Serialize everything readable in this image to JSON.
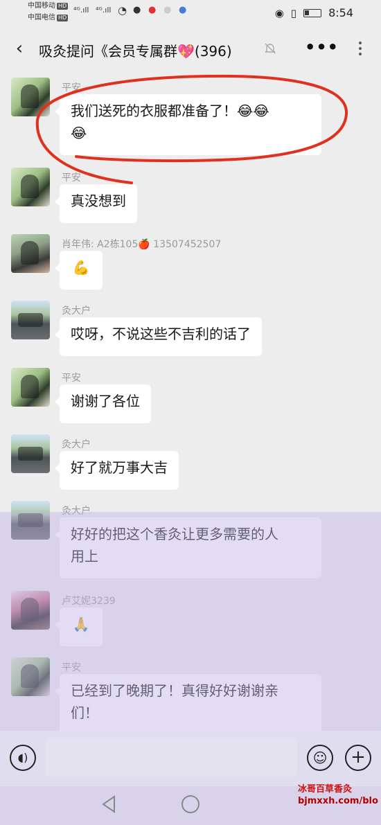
{
  "status_bar": {
    "carrier1": "中国移动",
    "carrier2": "中国电信",
    "hd": "HD",
    "signal1": "⁴ᴳ.ıll",
    "signal2": "⁴ᴳ.ıll",
    "time": "8:54"
  },
  "header": {
    "back_icon": "chevron-left",
    "title": "吸灸提问《会员专属群💖(396)",
    "more_icon": "ellipsis",
    "menu_icon": "vertical-dots"
  },
  "messages": [
    {
      "sender": "平安",
      "text": "我们送死的衣服都准备了！😂😂",
      "text2": "😂"
    },
    {
      "sender": "平安",
      "text": "真没想到"
    },
    {
      "sender": "肖年伟: A2栋105🍎 13507452507",
      "text": "💪"
    },
    {
      "sender": "灸大户",
      "text": "哎呀，不说这些不吉利的话了"
    },
    {
      "sender": "平安",
      "text": "谢谢了各位"
    },
    {
      "sender": "灸大户",
      "text": "好了就万事大吉"
    },
    {
      "sender": "灸大户",
      "text": "好好的把这个香灸让更多需要的人",
      "text2": "用上"
    },
    {
      "sender": "卢艾妮3239",
      "text": "🙏"
    },
    {
      "sender": "平安",
      "text": "已经到了晚期了！真得好好谢谢亲",
      "text2": "们！"
    }
  ],
  "input": {
    "value": "",
    "voice_icon": "voice-icon",
    "emoji_icon": "emoji-icon",
    "plus_icon": "plus-icon"
  },
  "watermark": {
    "line1": "冰哥百草香灸",
    "line2": "bjmxxh.com/blo"
  },
  "colors": {
    "background": "#ededed",
    "bubble": "#ffffff",
    "annotation": "#e0301e",
    "overlay": "#beb4e6"
  }
}
